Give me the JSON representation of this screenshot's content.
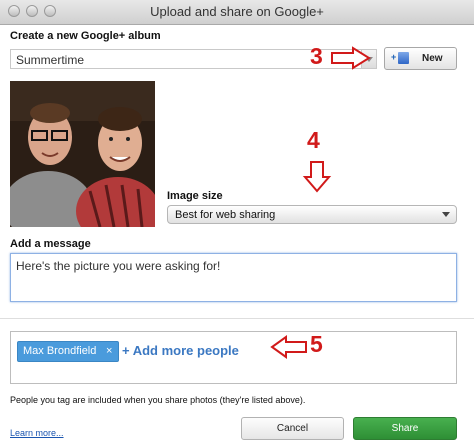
{
  "window": {
    "title": "Upload and share on Google+"
  },
  "album": {
    "label": "Create a new Google+ album",
    "value": "Summertime",
    "new_button": "New"
  },
  "annotations": {
    "n3": "3",
    "n4": "4",
    "n5": "5",
    "color": "#d11a1a"
  },
  "image_size": {
    "label": "Image size",
    "value": "Best for web sharing"
  },
  "message": {
    "label": "Add a message",
    "value": "Here's the picture you were asking for!"
  },
  "people": {
    "chips": [
      {
        "name": "Max Brondfield",
        "remove": "×"
      }
    ],
    "add_more": "+ Add more people",
    "note": "People you tag are included when you share photos (they're listed above)."
  },
  "footer": {
    "learn_more": "Learn more...",
    "cancel": "Cancel",
    "share": "Share"
  },
  "colors": {
    "accent": "#3b78c2",
    "chip": "#4a9bdc",
    "share": "#2e8f35"
  }
}
